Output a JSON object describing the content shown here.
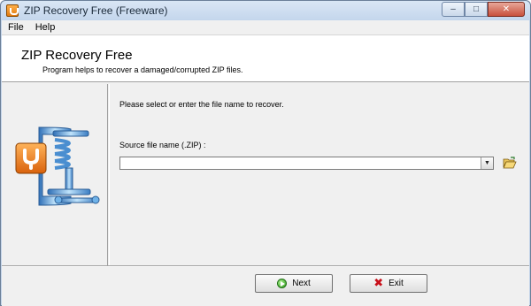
{
  "window": {
    "title": "ZIP Recovery Free (Freeware)",
    "controls": {
      "minimize": "–",
      "maximize": "□",
      "close": "✕"
    }
  },
  "menu": {
    "items": [
      "File",
      "Help"
    ]
  },
  "header": {
    "title": "ZIP Recovery Free",
    "subtitle": "Program helps to recover a damaged/corrupted ZIP files."
  },
  "form": {
    "instruction": "Please select or enter the file name to recover.",
    "source_label": "Source file name (.ZIP) :",
    "source_value": "",
    "dropdown_arrow": "▼"
  },
  "buttons": {
    "next": "Next",
    "exit": "Exit",
    "exit_glyph": "✖"
  },
  "icons": {
    "app": "app-icon",
    "logo": "zip-clamp-icon",
    "browse": "open-folder-icon",
    "next": "next-arrow-icon",
    "exit": "red-x-icon"
  },
  "colors": {
    "title_bar": "#c4d6ec",
    "logo_orange": "#e8781a",
    "logo_blue": "#6fb2e8",
    "next_green": "#2f9a1e",
    "exit_red": "#c8101a"
  }
}
